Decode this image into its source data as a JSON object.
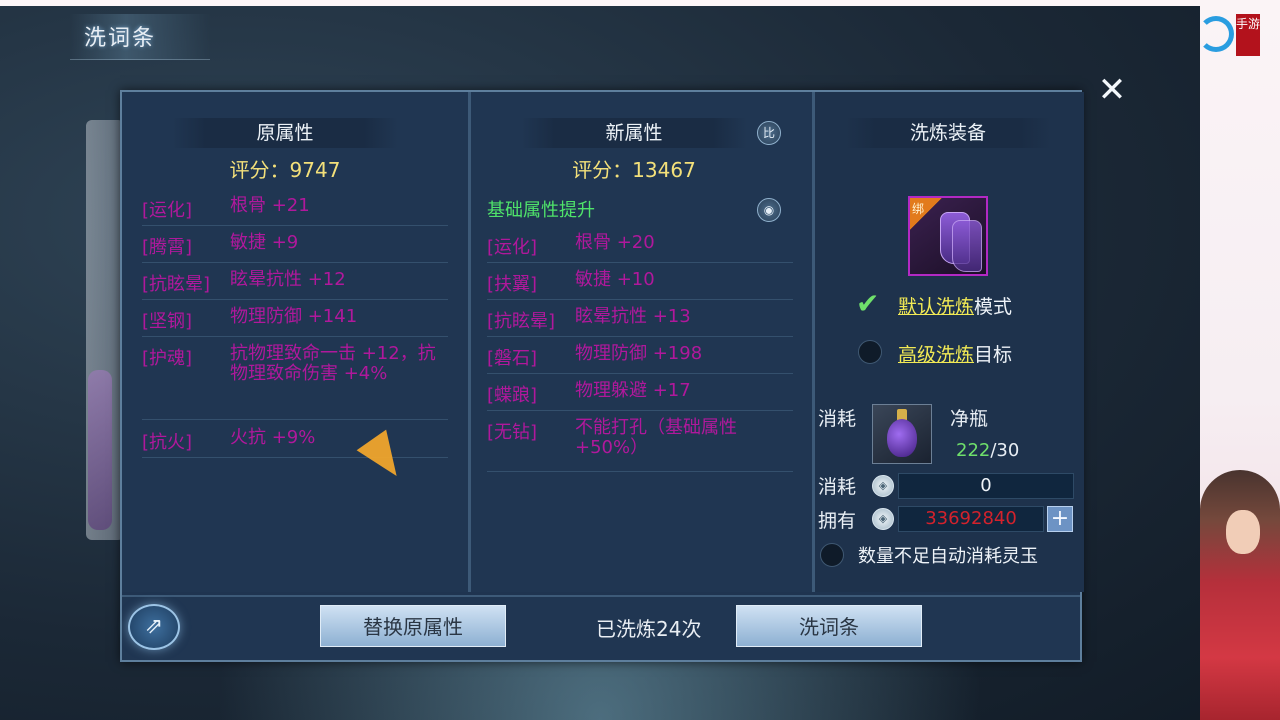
{
  "window": {
    "title": "洗词条",
    "close_icon": "close-icon"
  },
  "left_column": {
    "header": "原属性",
    "score": "评分：9747",
    "rows": [
      {
        "tag": "[运化]",
        "value": "根骨 +21"
      },
      {
        "tag": "[腾霄]",
        "value": "敏捷 +9"
      },
      {
        "tag": "[抗眩晕]",
        "value": "眩晕抗性 +12"
      },
      {
        "tag": "[坚钢]",
        "value": "物理防御 +141"
      },
      {
        "tag": "[护魂]",
        "value": "抗物理致命一击 +12，抗物理致命伤害 +4%"
      },
      {
        "tag": "[抗火]",
        "value": "火抗 +9%"
      }
    ]
  },
  "mid_column": {
    "header": "新属性",
    "compare_icon": "比",
    "score": "评分：13467",
    "basic_upgrade_label": "基础属性提升",
    "rows": [
      {
        "tag": "[运化]",
        "value": "根骨 +20"
      },
      {
        "tag": "[扶翼]",
        "value": "敏捷 +10"
      },
      {
        "tag": "[抗眩晕]",
        "value": "眩晕抗性 +13"
      },
      {
        "tag": "[磐石]",
        "value": "物理防御 +198"
      },
      {
        "tag": "[蝶踉]",
        "value": "物理躲避 +17"
      },
      {
        "tag": "[无钻]",
        "value": "不能打孔（基础属性+50%）"
      }
    ]
  },
  "right_column": {
    "header": "洗炼装备",
    "bind_label": "绑",
    "mode_default_link": "默认洗炼",
    "mode_default_suffix": "模式",
    "mode_advanced_link": "高级洗炼",
    "mode_advanced_suffix": "目标",
    "consume_label": "消耗",
    "item_name": "净瓶",
    "item_have": "222",
    "item_need": "/30",
    "consume_label2": "消耗",
    "consume_value": "0",
    "own_label": "拥有",
    "own_value": "33692840",
    "auto_consume_text": "数量不足自动消耗灵玉"
  },
  "bottom_bar": {
    "replace_button": "替换原属性",
    "count_text": "已洗炼24次",
    "wash_button": "洗词条"
  },
  "branding": {
    "logo_text": "手游"
  },
  "colors": {
    "attribute_text": "#b0189c",
    "score_text": "#f3e07a",
    "upgrade_text": "#4fe36a",
    "own_value_text": "#d3222c",
    "link_text": "#f2ea55"
  }
}
